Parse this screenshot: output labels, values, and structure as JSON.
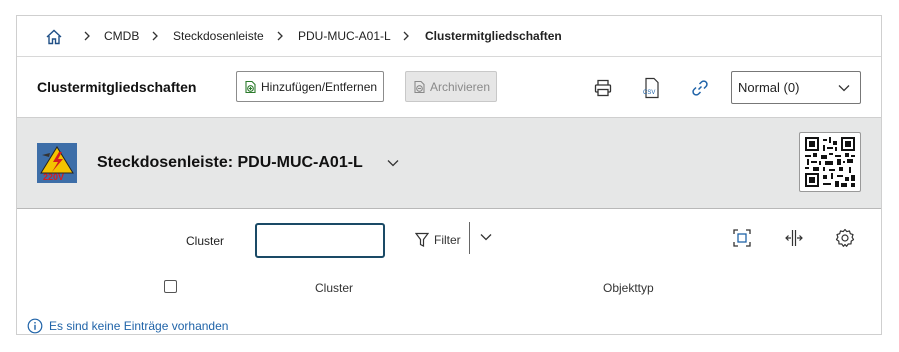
{
  "breadcrumb": {
    "items": [
      "CMDB",
      "Steckdosenleiste",
      "PDU-MUC-A01-L"
    ],
    "current": "Clustermitgliedschaften"
  },
  "toolbar": {
    "title": "Clustermitgliedschaften",
    "add_remove_label": "Hinzufügen/Entfernen",
    "archive_label": "Archivieren",
    "csv_icon_text": "CSV",
    "view_select_value": "Normal (0)"
  },
  "object": {
    "title": "Steckdosenleiste: PDU-MUC-A01-L",
    "image_text": "220V"
  },
  "list": {
    "filter_label": "Cluster",
    "filter_value": "",
    "filter_button_label": "Filter",
    "columns": [
      "Cluster",
      "Objekttyp"
    ],
    "empty_message": "Es sind keine Einträge vorhanden"
  },
  "colors": {
    "accent": "#1f63a8",
    "header_bg": "#e6e7e7",
    "input_border": "#1a4a66"
  },
  "icons": [
    "home-icon",
    "chevron-right-icon",
    "add-document-icon",
    "archive-icon",
    "printer-icon",
    "csv-icon",
    "link-icon",
    "chevron-down-icon",
    "qr-code-icon",
    "filter-icon",
    "fullscreen-icon",
    "column-resize-icon",
    "gear-icon",
    "info-icon"
  ]
}
